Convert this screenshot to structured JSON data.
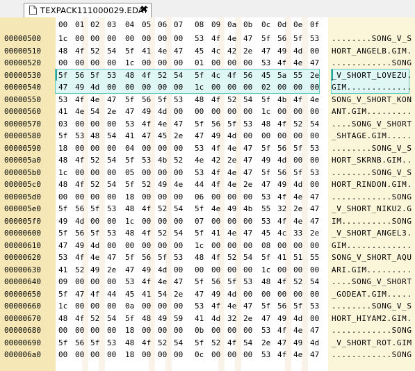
{
  "tab": {
    "label": "TEXPACK111000029.EDAT",
    "close_glyph": "✖",
    "icon": "document-icon"
  },
  "header": {
    "columns": [
      "00",
      "01",
      "02",
      "03",
      "04",
      "05",
      "06",
      "07",
      "08",
      "09",
      "0a",
      "0b",
      "0c",
      "0d",
      "0e",
      "0f"
    ]
  },
  "selection": {
    "start_offset": "00000530",
    "end_offset": "0000054f",
    "cursor_offset": "00000530"
  },
  "rows": [
    {
      "offset": "00000500",
      "bytes": [
        "1c",
        "00",
        "00",
        "00",
        "00",
        "00",
        "00",
        "00",
        "53",
        "4f",
        "4e",
        "47",
        "5f",
        "56",
        "5f",
        "53"
      ],
      "ascii": "........SONG_V_S"
    },
    {
      "offset": "00000510",
      "bytes": [
        "48",
        "4f",
        "52",
        "54",
        "5f",
        "41",
        "4e",
        "47",
        "45",
        "4c",
        "42",
        "2e",
        "47",
        "49",
        "4d",
        "00"
      ],
      "ascii": "HORT_ANGELB.GIM."
    },
    {
      "offset": "00000520",
      "bytes": [
        "00",
        "00",
        "00",
        "00",
        "1c",
        "00",
        "00",
        "00",
        "01",
        "00",
        "00",
        "00",
        "53",
        "4f",
        "4e",
        "47"
      ],
      "ascii": "............SONG"
    },
    {
      "offset": "00000530",
      "bytes": [
        "5f",
        "56",
        "5f",
        "53",
        "48",
        "4f",
        "52",
        "54",
        "5f",
        "4c",
        "4f",
        "56",
        "45",
        "5a",
        "55",
        "2e"
      ],
      "ascii": "_V_SHORT_LOVEZU."
    },
    {
      "offset": "00000540",
      "bytes": [
        "47",
        "49",
        "4d",
        "00",
        "00",
        "00",
        "00",
        "00",
        "1c",
        "00",
        "00",
        "00",
        "02",
        "00",
        "00",
        "00"
      ],
      "ascii": "GIM............."
    },
    {
      "offset": "00000550",
      "bytes": [
        "53",
        "4f",
        "4e",
        "47",
        "5f",
        "56",
        "5f",
        "53",
        "48",
        "4f",
        "52",
        "54",
        "5f",
        "4b",
        "4f",
        "4e"
      ],
      "ascii": "SONG_V_SHORT_KON"
    },
    {
      "offset": "00000560",
      "bytes": [
        "41",
        "4e",
        "54",
        "2e",
        "47",
        "49",
        "4d",
        "00",
        "00",
        "00",
        "00",
        "00",
        "1c",
        "00",
        "00",
        "00"
      ],
      "ascii": "ANT.GIM........."
    },
    {
      "offset": "00000570",
      "bytes": [
        "03",
        "00",
        "00",
        "00",
        "53",
        "4f",
        "4e",
        "47",
        "5f",
        "56",
        "5f",
        "53",
        "48",
        "4f",
        "52",
        "54"
      ],
      "ascii": "....SONG_V_SHORT"
    },
    {
      "offset": "00000580",
      "bytes": [
        "5f",
        "53",
        "48",
        "54",
        "41",
        "47",
        "45",
        "2e",
        "47",
        "49",
        "4d",
        "00",
        "00",
        "00",
        "00",
        "00"
      ],
      "ascii": "_SHTAGE.GIM....."
    },
    {
      "offset": "00000590",
      "bytes": [
        "18",
        "00",
        "00",
        "00",
        "04",
        "00",
        "00",
        "00",
        "53",
        "4f",
        "4e",
        "47",
        "5f",
        "56",
        "5f",
        "53"
      ],
      "ascii": "........SONG_V_S"
    },
    {
      "offset": "000005a0",
      "bytes": [
        "48",
        "4f",
        "52",
        "54",
        "5f",
        "53",
        "4b",
        "52",
        "4e",
        "42",
        "2e",
        "47",
        "49",
        "4d",
        "00",
        "00"
      ],
      "ascii": "HORT_SKRNB.GIM.."
    },
    {
      "offset": "000005b0",
      "bytes": [
        "1c",
        "00",
        "00",
        "00",
        "05",
        "00",
        "00",
        "00",
        "53",
        "4f",
        "4e",
        "47",
        "5f",
        "56",
        "5f",
        "53"
      ],
      "ascii": "........SONG_V_S"
    },
    {
      "offset": "000005c0",
      "bytes": [
        "48",
        "4f",
        "52",
        "54",
        "5f",
        "52",
        "49",
        "4e",
        "44",
        "4f",
        "4e",
        "2e",
        "47",
        "49",
        "4d",
        "00"
      ],
      "ascii": "HORT_RINDON.GIM."
    },
    {
      "offset": "000005d0",
      "bytes": [
        "00",
        "00",
        "00",
        "00",
        "18",
        "00",
        "00",
        "00",
        "06",
        "00",
        "00",
        "00",
        "53",
        "4f",
        "4e",
        "47"
      ],
      "ascii": "............SONG"
    },
    {
      "offset": "000005e0",
      "bytes": [
        "5f",
        "56",
        "5f",
        "53",
        "48",
        "4f",
        "52",
        "54",
        "5f",
        "4e",
        "49",
        "4b",
        "55",
        "32",
        "2e",
        "47"
      ],
      "ascii": "_V_SHORT_NIKU2.G"
    },
    {
      "offset": "000005f0",
      "bytes": [
        "49",
        "4d",
        "00",
        "00",
        "1c",
        "00",
        "00",
        "00",
        "07",
        "00",
        "00",
        "00",
        "53",
        "4f",
        "4e",
        "47"
      ],
      "ascii": "IM..........SONG"
    },
    {
      "offset": "00000600",
      "bytes": [
        "5f",
        "56",
        "5f",
        "53",
        "48",
        "4f",
        "52",
        "54",
        "5f",
        "41",
        "4e",
        "47",
        "45",
        "4c",
        "33",
        "2e"
      ],
      "ascii": "_V_SHORT_ANGEL3."
    },
    {
      "offset": "00000610",
      "bytes": [
        "47",
        "49",
        "4d",
        "00",
        "00",
        "00",
        "00",
        "00",
        "1c",
        "00",
        "00",
        "00",
        "08",
        "00",
        "00",
        "00"
      ],
      "ascii": "GIM............."
    },
    {
      "offset": "00000620",
      "bytes": [
        "53",
        "4f",
        "4e",
        "47",
        "5f",
        "56",
        "5f",
        "53",
        "48",
        "4f",
        "52",
        "54",
        "5f",
        "41",
        "51",
        "55"
      ],
      "ascii": "SONG_V_SHORT_AQU"
    },
    {
      "offset": "00000630",
      "bytes": [
        "41",
        "52",
        "49",
        "2e",
        "47",
        "49",
        "4d",
        "00",
        "00",
        "00",
        "00",
        "00",
        "1c",
        "00",
        "00",
        "00"
      ],
      "ascii": "ARI.GIM........."
    },
    {
      "offset": "00000640",
      "bytes": [
        "09",
        "00",
        "00",
        "00",
        "53",
        "4f",
        "4e",
        "47",
        "5f",
        "56",
        "5f",
        "53",
        "48",
        "4f",
        "52",
        "54"
      ],
      "ascii": "....SONG_V_SHORT"
    },
    {
      "offset": "00000650",
      "bytes": [
        "5f",
        "47",
        "4f",
        "44",
        "45",
        "41",
        "54",
        "2e",
        "47",
        "49",
        "4d",
        "00",
        "00",
        "00",
        "00",
        "00"
      ],
      "ascii": "_GODEAT.GIM....."
    },
    {
      "offset": "00000660",
      "bytes": [
        "1c",
        "00",
        "00",
        "00",
        "0a",
        "00",
        "00",
        "00",
        "53",
        "4f",
        "4e",
        "47",
        "5f",
        "56",
        "5f",
        "53"
      ],
      "ascii": "........SONG_V_S"
    },
    {
      "offset": "00000670",
      "bytes": [
        "48",
        "4f",
        "52",
        "54",
        "5f",
        "48",
        "49",
        "59",
        "41",
        "4d",
        "32",
        "2e",
        "47",
        "49",
        "4d",
        "00"
      ],
      "ascii": "HORT_HIYAM2.GIM."
    },
    {
      "offset": "00000680",
      "bytes": [
        "00",
        "00",
        "00",
        "00",
        "18",
        "00",
        "00",
        "00",
        "0b",
        "00",
        "00",
        "00",
        "53",
        "4f",
        "4e",
        "47"
      ],
      "ascii": "............SONG"
    },
    {
      "offset": "00000690",
      "bytes": [
        "5f",
        "56",
        "5f",
        "53",
        "48",
        "4f",
        "52",
        "54",
        "5f",
        "52",
        "4f",
        "54",
        "2e",
        "47",
        "49",
        "4d"
      ],
      "ascii": "_V_SHORT_ROT.GIM"
    },
    {
      "offset": "000006a0",
      "bytes": [
        "00",
        "00",
        "00",
        "00",
        "18",
        "00",
        "00",
        "00",
        "0c",
        "00",
        "00",
        "00",
        "53",
        "4f",
        "4e",
        "47"
      ],
      "ascii": "............SONG"
    }
  ]
}
